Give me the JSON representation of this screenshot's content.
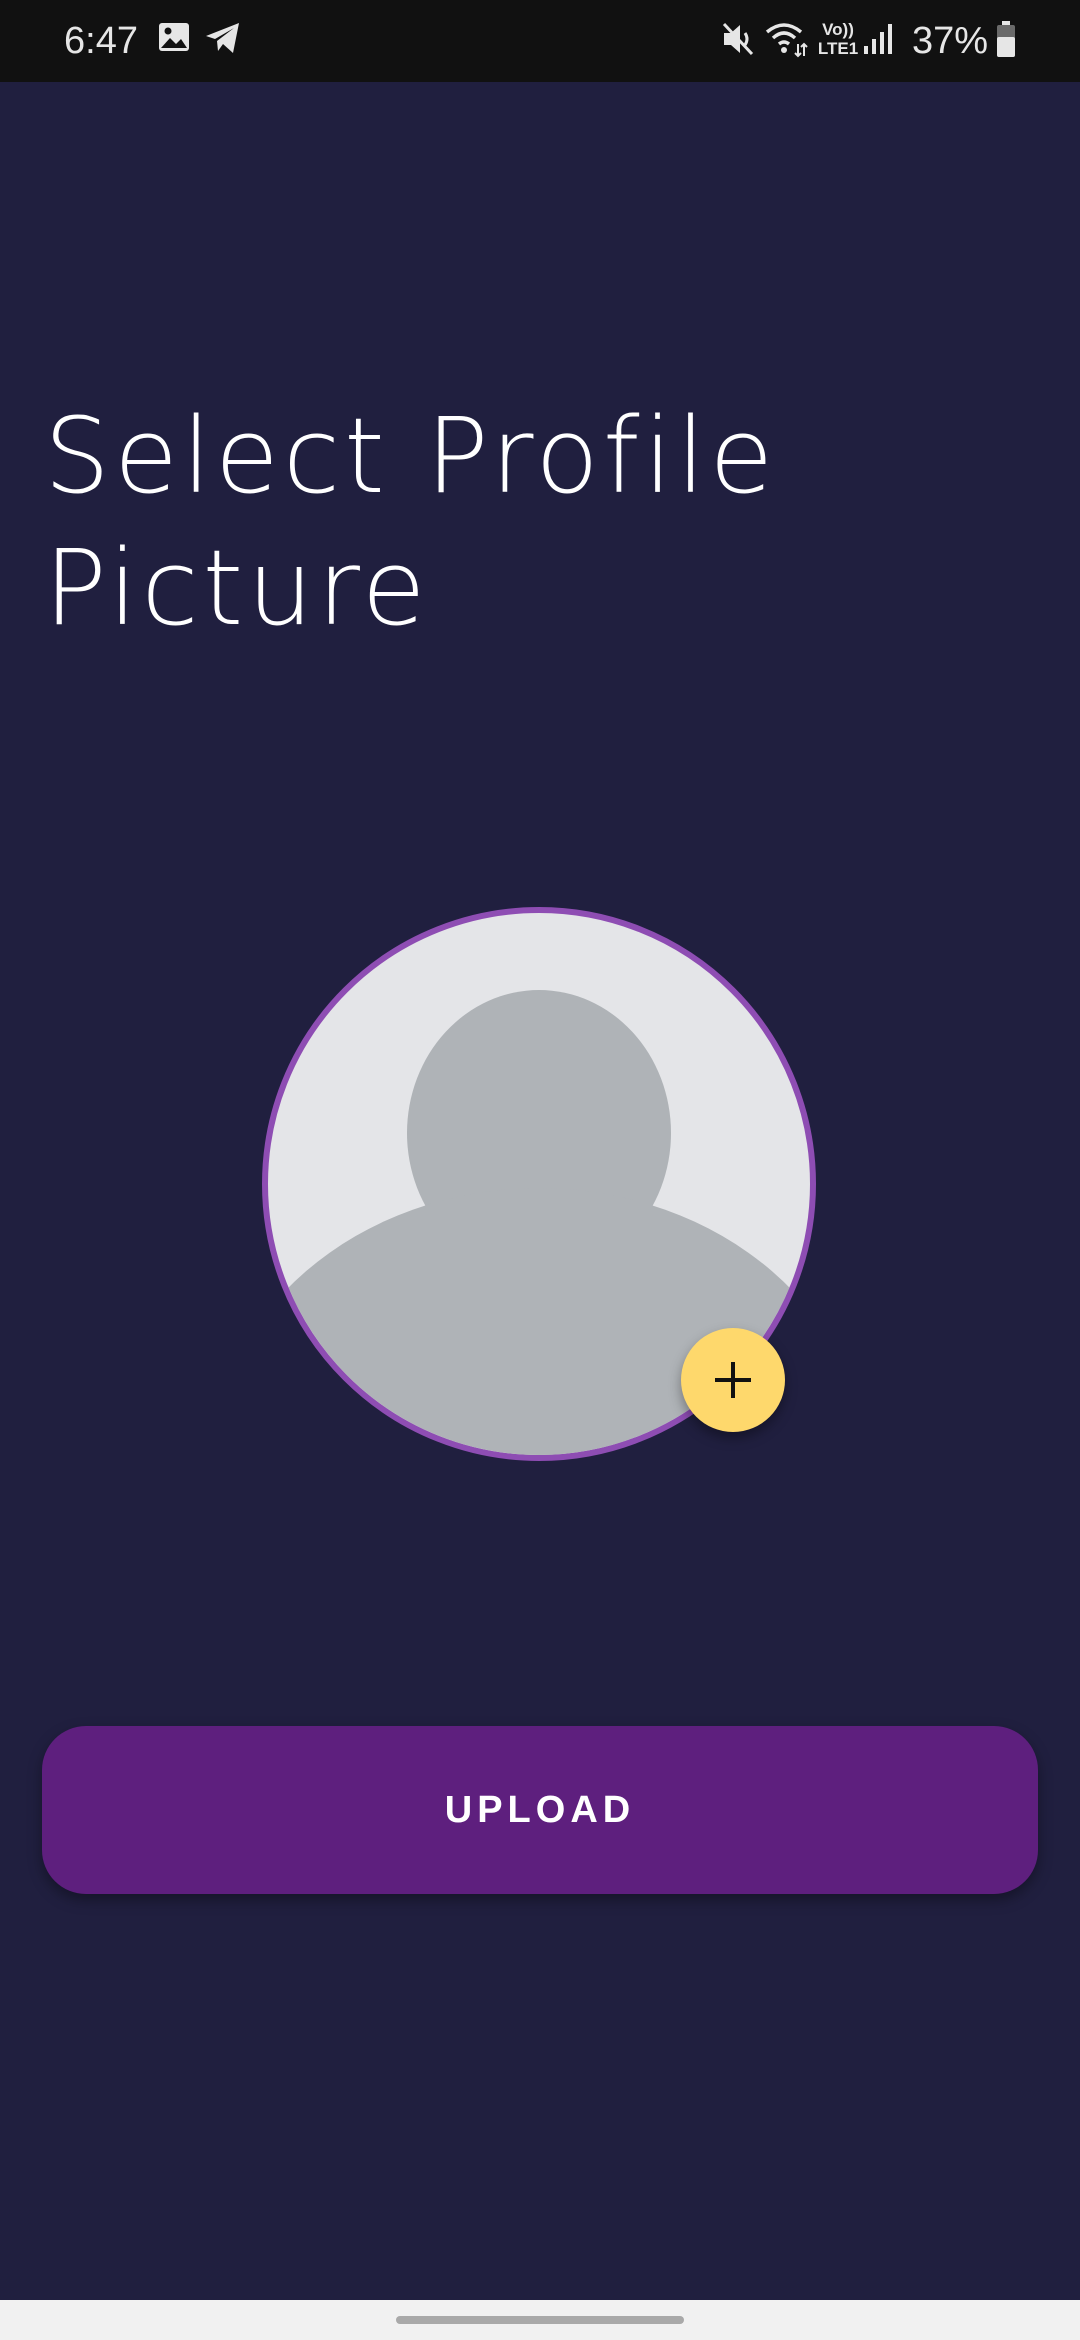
{
  "status_bar": {
    "time": "6:47",
    "battery_percent": "37%",
    "icons": [
      "gallery-icon",
      "telegram-icon",
      "mute-icon",
      "wifi-icon",
      "volte-lte1-icon",
      "signal-icon",
      "battery-icon"
    ],
    "volte_label": "Vo))",
    "lte_label": "LTE1"
  },
  "main": {
    "title": "Select Profile Picture",
    "avatar": {
      "icon": "default-user-avatar",
      "border_color": "#8e4db3"
    },
    "add_button": {
      "icon": "plus-icon",
      "color": "#fed86c"
    },
    "upload_button": {
      "label": "UPLOAD",
      "color": "#5e1f7e"
    }
  },
  "theme": {
    "background": "#201f3f"
  }
}
